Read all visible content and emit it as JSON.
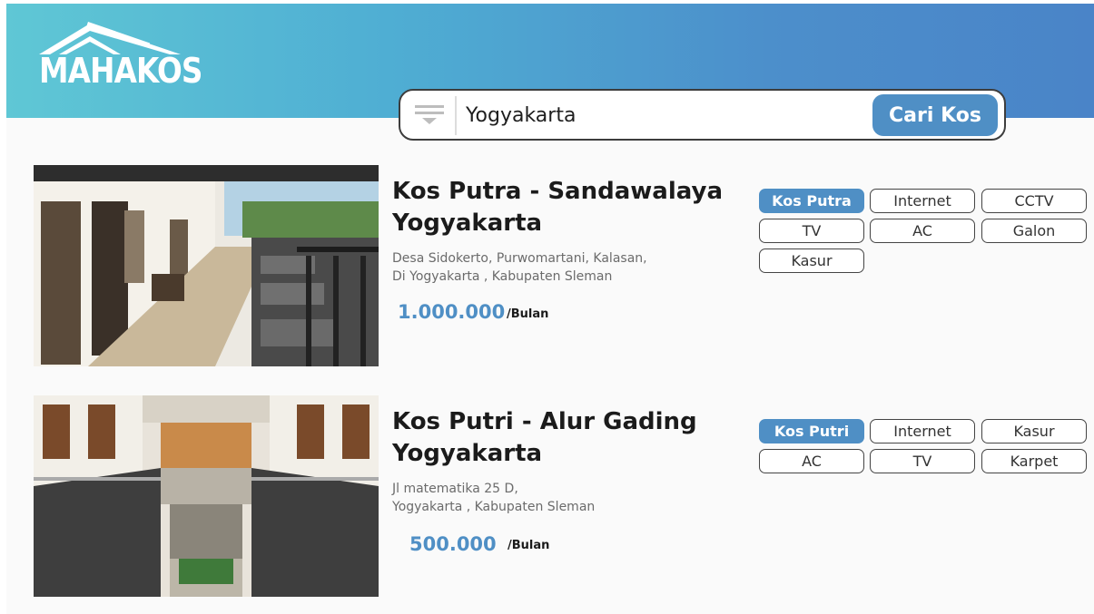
{
  "brand": {
    "name": "MAHAKOS"
  },
  "search": {
    "value": "Yogyakarta",
    "button_label": "Cari Kos"
  },
  "listings": [
    {
      "name_line1": "Kos Putra - Sandawalaya",
      "name_line2": "Yogyakarta",
      "address_line1": "Desa Sidokerto, Purwomartani, Kalasan,",
      "address_line2": "Di Yogyakarta , Kabupaten Sleman",
      "price": "1.000.000",
      "per": "/Bulan",
      "tags": [
        "Kos Putra",
        "Internet",
        "CCTV",
        "TV",
        "AC",
        "Galon",
        "Kasur"
      ]
    },
    {
      "name_line1": "Kos Putri - Alur Gading",
      "name_line2": "Yogyakarta",
      "address_line1": "Jl matematika 25 D,",
      "address_line2": "Yogyakarta , Kabupaten Sleman",
      "price": "500.000",
      "per": "/Bulan",
      "tags": [
        "Kos Putri",
        "Internet",
        "Kasur",
        "AC",
        "TV",
        "Karpet"
      ]
    }
  ],
  "colors": {
    "accent": "#4f8fc5",
    "header_start": "#5fc7d5",
    "header_end": "#4a84c8"
  }
}
